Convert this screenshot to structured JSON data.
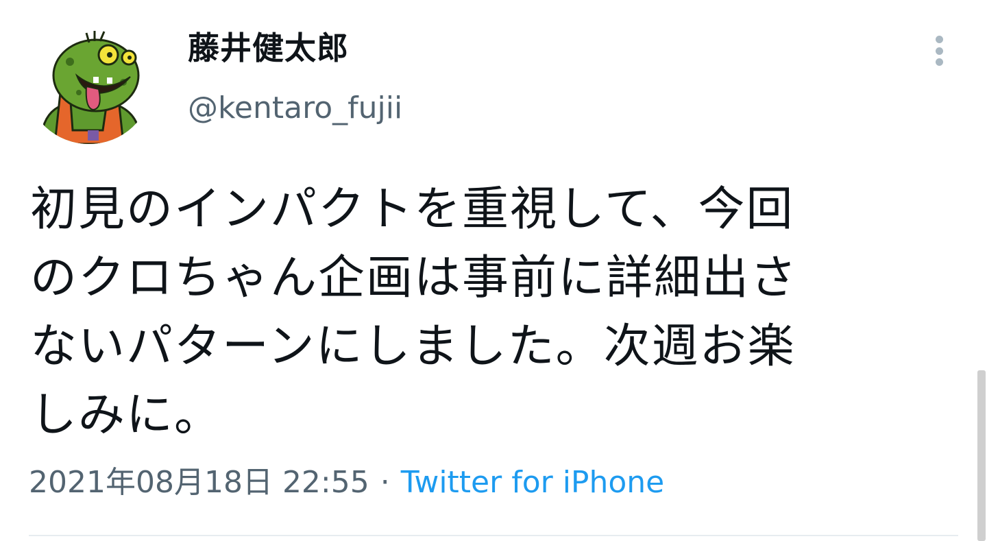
{
  "author": {
    "display_name": "藤井健太郎",
    "handle": "@kentaro_fujii",
    "avatar_icon": "green-monster-avatar-icon"
  },
  "tweet": {
    "lines": [
      "初見のインパクトを重視して、今回",
      "のクロちゃん企画は事前に詳細出さ",
      "ないパターンにしました。次週お楽",
      "しみに。"
    ]
  },
  "meta": {
    "timestamp": "2021年08月18日 22:55",
    "separator": "·",
    "source": "Twitter for iPhone"
  },
  "colors": {
    "text": "#0f1419",
    "secondary": "#536471",
    "link": "#1d9bf0",
    "divider": "#e6ecf0"
  }
}
